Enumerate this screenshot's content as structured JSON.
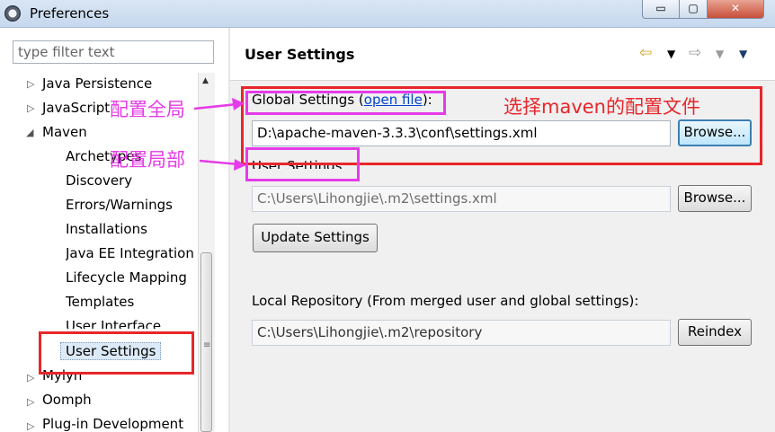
{
  "window": {
    "title": "Preferences",
    "controls": {
      "minimize": "▭",
      "maximize": "▢",
      "close": "✕"
    }
  },
  "sidebar": {
    "filter_placeholder": "type filter text",
    "items": [
      {
        "label": "Java Persistence",
        "expanded": false
      },
      {
        "label": "JavaScript",
        "expanded": false
      },
      {
        "label": "Maven",
        "expanded": true
      },
      {
        "label": "Archetypes"
      },
      {
        "label": "Discovery"
      },
      {
        "label": "Errors/Warnings"
      },
      {
        "label": "Installations"
      },
      {
        "label": "Java EE Integration"
      },
      {
        "label": "Lifecycle Mapping"
      },
      {
        "label": "Templates"
      },
      {
        "label": "User Interface"
      },
      {
        "label": "User Settings",
        "selected": true
      },
      {
        "label": "Mylyn",
        "expanded": false
      },
      {
        "label": "Oomph",
        "expanded": false
      },
      {
        "label": "Plug-in Development",
        "expanded": false
      }
    ]
  },
  "main": {
    "title": "User Settings",
    "nav_icons": [
      "back-arrow-icon",
      "forward-arrow-icon",
      "view-menu-icon"
    ],
    "global_settings": {
      "label_before_link": "Global Settings (",
      "link": "open file",
      "label_after_link": "):",
      "value": "D:\\apache-maven-3.3.3\\conf\\settings.xml",
      "browse": "Browse..."
    },
    "user_settings": {
      "label": "User Settings:",
      "value": "C:\\Users\\Lihongjie\\.m2\\settings.xml",
      "browse": "Browse..."
    },
    "update_button": "Update Settings",
    "local_repository": {
      "label": "Local Repository (From merged user and global settings):",
      "value": "C:\\Users\\Lihongjie\\.m2\\repository",
      "reindex": "Reindex"
    }
  },
  "annotations": {
    "global": "配置全局",
    "local": "配置局部",
    "select_file": "选择maven的配置文件",
    "colors": {
      "red": "#e8262a",
      "pink": "#e63be8"
    }
  }
}
